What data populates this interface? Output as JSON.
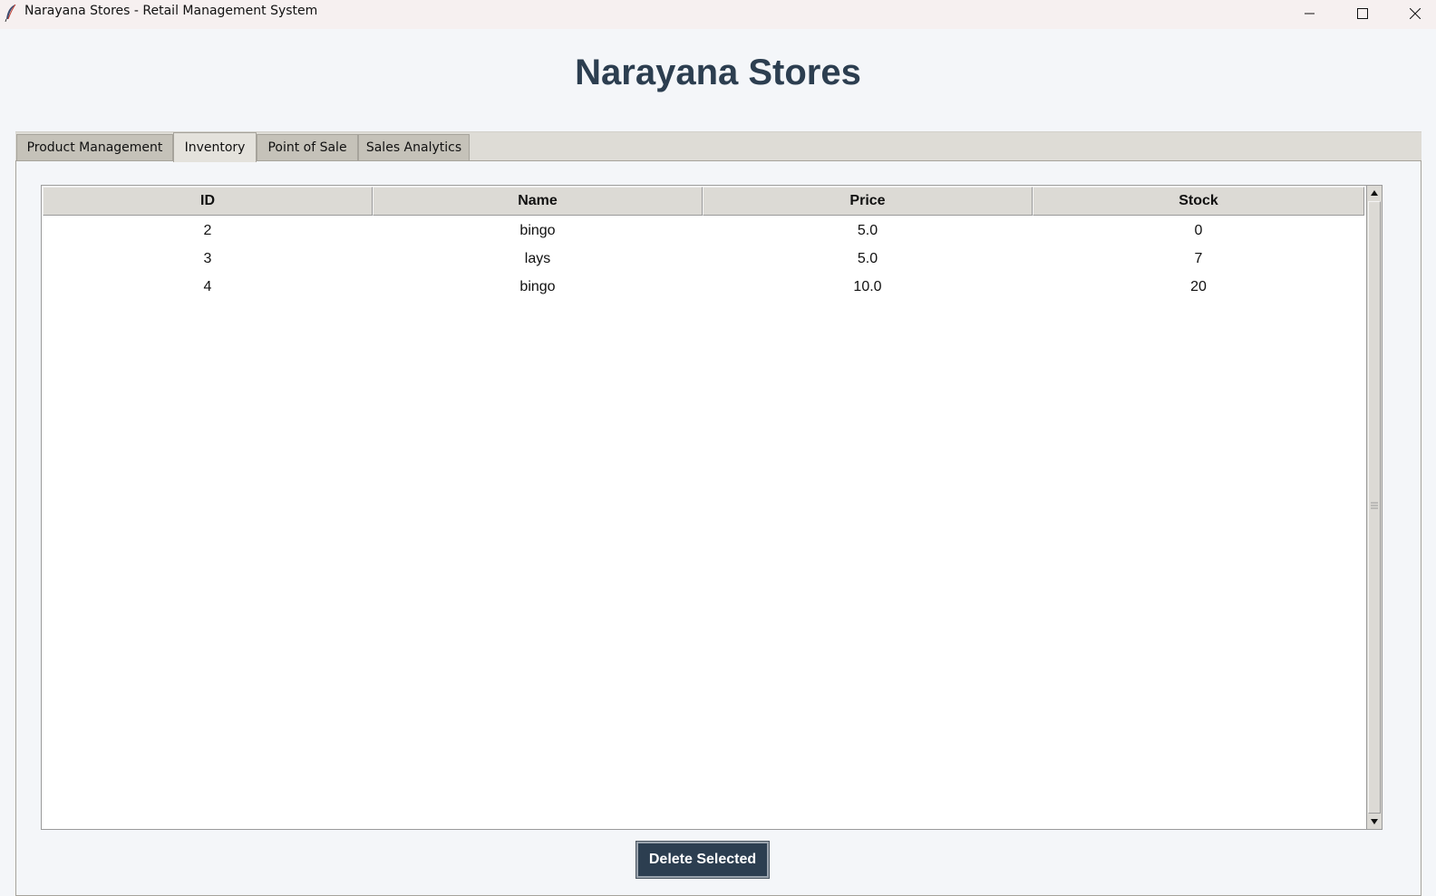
{
  "window": {
    "title": "Narayana Stores - Retail Management System",
    "icon": "feather-icon",
    "controls": [
      "minimize-icon",
      "maximize-icon",
      "close-icon"
    ]
  },
  "header": {
    "title": "Narayana Stores",
    "color": "#2c3e50"
  },
  "tabs": [
    {
      "label": "Product Management",
      "active": false
    },
    {
      "label": "Inventory",
      "active": true
    },
    {
      "label": "Point of Sale",
      "active": false
    },
    {
      "label": "Sales Analytics",
      "active": false
    }
  ],
  "inventory_table": {
    "columns": [
      "ID",
      "Name",
      "Price",
      "Stock"
    ],
    "rows": [
      [
        "2",
        "bingo",
        "5.0",
        "0"
      ],
      [
        "3",
        "lays",
        "5.0",
        "7"
      ],
      [
        "4",
        "bingo",
        "10.0",
        "20"
      ]
    ]
  },
  "actions": {
    "delete_label": "Delete Selected",
    "delete_color": "#2c3e50"
  }
}
